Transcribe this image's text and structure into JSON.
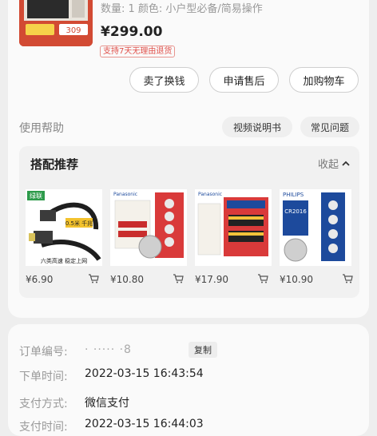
{
  "item": {
    "spec": "数量: 1  颜色: 小户型必备/简易操作",
    "price": "¥299.00",
    "guarantee_badge": "支持7天无理由退货",
    "thumb_price": "309"
  },
  "actions": {
    "sell_label": "卖了换钱",
    "after_sale_label": "申请售后",
    "add_cart_label": "加购物车"
  },
  "help": {
    "label": "使用帮助",
    "video_manual": "视频说明书",
    "faq": "常见问题"
  },
  "recommend": {
    "title": "搭配推荐",
    "collapse_label": "收起",
    "products": [
      {
        "price": "¥6.90",
        "brand": "绿联",
        "caption": "六类高速 稳定上网",
        "tag": "0.5米 千兆"
      },
      {
        "price": "¥10.80",
        "brand": "Panasonic"
      },
      {
        "price": "¥17.90",
        "brand": "Panasonic"
      },
      {
        "price": "¥10.90",
        "brand": "PHILIPS",
        "tag": "CR2016"
      }
    ]
  },
  "order": {
    "number_label": "订单编号:",
    "number_value": "·  ····· ·8",
    "copy_label": "复制",
    "time_label": "下单时间:",
    "time_value": "2022-03-15 16:43:54",
    "pay_label": "支付方式:",
    "pay_value": "微信支付",
    "pay_time_label": "支付时间:",
    "pay_time_value": "2022-03-15 16:44:03"
  },
  "colors": {
    "badge_red": "#e0504a",
    "card_bg": "#fafafa",
    "page_bg": "#eeeeee"
  }
}
